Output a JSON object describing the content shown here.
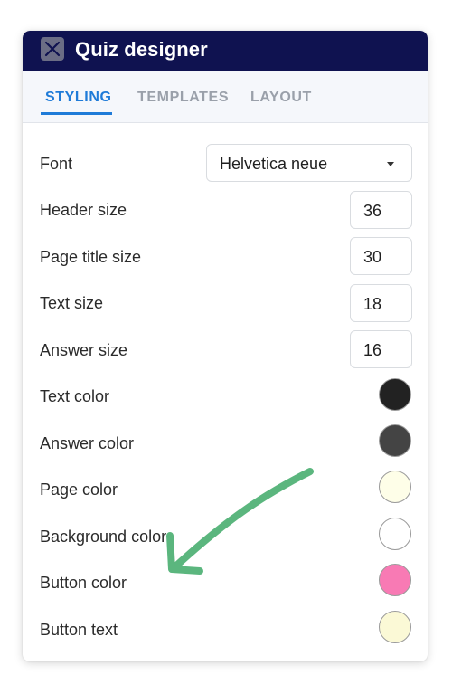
{
  "window": {
    "title": "Quiz designer"
  },
  "tabs": [
    {
      "label": "STYLING",
      "active": true
    },
    {
      "label": "TEMPLATES",
      "active": false
    },
    {
      "label": "LAYOUT",
      "active": false
    }
  ],
  "settings": {
    "font": {
      "label": "Font",
      "value": "Helvetica neue"
    },
    "header_size": {
      "label": "Header size",
      "value": "36"
    },
    "page_title_size": {
      "label": "Page title size",
      "value": "30"
    },
    "text_size": {
      "label": "Text size",
      "value": "18"
    },
    "answer_size": {
      "label": "Answer size",
      "value": "16"
    },
    "text_color": {
      "label": "Text color",
      "color": "#222222"
    },
    "answer_color": {
      "label": "Answer color",
      "color": "#444444"
    },
    "page_color": {
      "label": "Page color",
      "color": "#fefee8"
    },
    "background_color": {
      "label": "Background color",
      "color": "#ffffff"
    },
    "button_color": {
      "label": "Button color",
      "color": "#f87ab4"
    },
    "button_text": {
      "label": "Button text",
      "color": "#fbf9d6"
    }
  },
  "colors": {
    "header_bg": "#0f1250",
    "accent": "#1f7bd8",
    "annotation_arrow": "#5bb67e"
  },
  "icons": {
    "close": "close-icon",
    "dropdown": "caret-down-icon"
  }
}
